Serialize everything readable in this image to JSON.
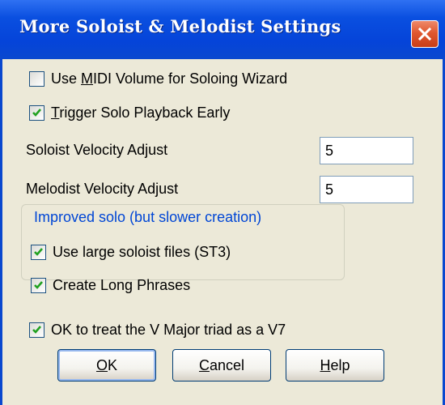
{
  "window": {
    "title": "More Soloist & Melodist Settings"
  },
  "options": {
    "midi_volume": {
      "prefix": "Use ",
      "mnemonic": "M",
      "suffix": "IDI Volume for Soloing Wizard",
      "checked": false
    },
    "trigger_early": {
      "prefix": "",
      "mnemonic": "T",
      "suffix": "rigger Solo Playback Early",
      "checked": true
    }
  },
  "fields": {
    "soloist_velocity": {
      "label": "Soloist Velocity Adjust",
      "value": "5"
    },
    "melodist_velocity": {
      "label": "Melodist Velocity Adjust",
      "value": "5"
    }
  },
  "group": {
    "title": "Improved solo (but slower creation)",
    "large_files": {
      "label": "Use large soloist files (ST3)",
      "checked": true
    },
    "long_phrases": {
      "label": "Create Long Phrases",
      "checked": true
    }
  },
  "v7_option": {
    "label": "OK to treat the V Major triad as a V7",
    "checked": true
  },
  "buttons": {
    "ok": {
      "mnemonic": "O",
      "rest": "K"
    },
    "cancel": {
      "mnemonic": "C",
      "rest": "ancel"
    },
    "help": {
      "mnemonic": "H",
      "rest": "elp"
    }
  },
  "colors": {
    "titlebar": "#0544d9",
    "face": "#ece9d8",
    "group_title": "#0046d5",
    "close": "#e0582f",
    "checkmark": "#21a121"
  },
  "icons": [
    "close-icon",
    "checkmark-icon"
  ]
}
